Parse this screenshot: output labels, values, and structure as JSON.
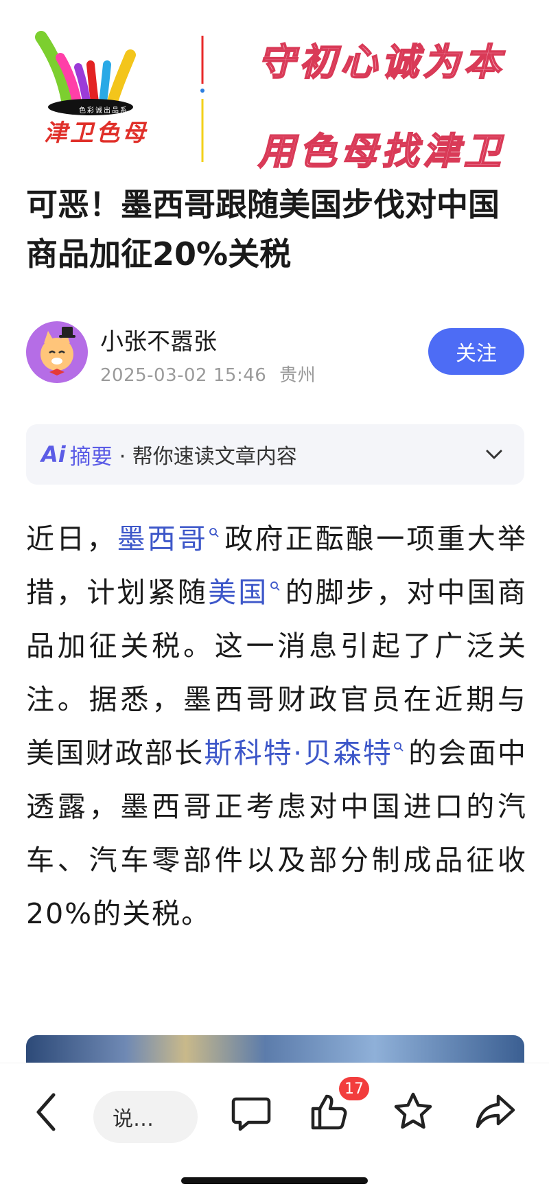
{
  "banner": {
    "logo_text": "津卫色母",
    "logo_band_text": "色彩诚出品系",
    "slogan_top": "守初心诚为本",
    "slogan_bottom": "用色母找津卫"
  },
  "article": {
    "headline": "可恶！墨西哥跟随美国步伐对中国商品加征20%关税",
    "author": {
      "name": "小张不嚣张",
      "timestamp": "2025-03-02 15:46",
      "location": "贵州",
      "follow_label": "关注"
    },
    "ai_summary": {
      "logo": "Ai",
      "title": "摘要",
      "description": "· 帮你速读文章内容"
    },
    "body": {
      "p1": "近日，",
      "link1": "墨西哥",
      "p2": "政府正酝酿一项重大举措，计划紧随",
      "link2": "美国",
      "p3": "的脚步，对中国商品加征关税。这一消息引起了广泛关注。据悉，墨西哥财政官员在近期与美国财政部长",
      "link3": "斯科特·贝森特",
      "p4": "的会面中透露，墨西哥正考虑对中国进口的汽车、汽车零部件以及部分制成品征收20%的关税。"
    }
  },
  "bottom_bar": {
    "comment_placeholder": "说…",
    "like_count": "17"
  },
  "icons": {
    "back": "chevron-left-icon",
    "comment": "comment-icon",
    "like": "thumbs-up-icon",
    "favorite": "star-icon",
    "share": "share-icon",
    "search": "search-icon"
  },
  "colors": {
    "accent_blue": "#4d6cf5",
    "link_blue": "#3d57c9",
    "badge_red": "#f23d3d",
    "ai_purple": "#5b5ce6"
  }
}
